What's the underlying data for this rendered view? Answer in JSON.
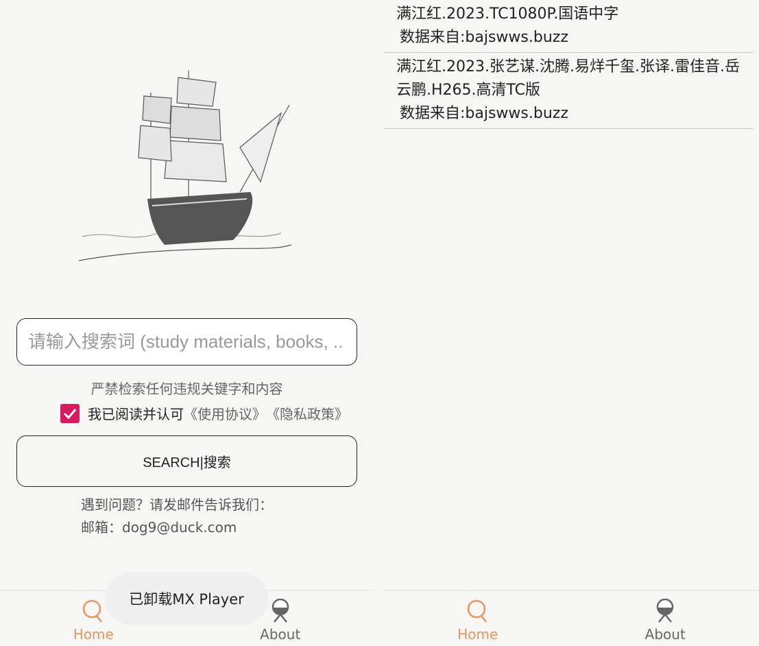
{
  "left": {
    "search": {
      "placeholder": "请输入搜索词 (study materials, books, ..."
    },
    "warning": "严禁检索任何违规关键字和内容",
    "agree": {
      "checked": true,
      "text": "我已阅读并认可",
      "terms": "《使用协议》",
      "privacy": "《隐私政策》"
    },
    "search_button": "SEARCH|搜索",
    "help_line1": "遇到问题？请发邮件告诉我们：",
    "help_line2": "邮箱：dog9@duck.com",
    "toast": "已卸载MX Player"
  },
  "nav": {
    "home": "Home",
    "about": "About",
    "active_color": "#e8955e",
    "inactive_color": "#666666"
  },
  "results": [
    {
      "title": "满江红.2023.TC1080P.国语中字",
      "source": "数据来自:bajswws.buzz"
    },
    {
      "title": "满江红.2023.张艺谋.沈腾.易烊千玺.张译.雷佳音.岳云鹏.H265.高清TC版",
      "source": "数据来自:bajswws.buzz"
    }
  ]
}
